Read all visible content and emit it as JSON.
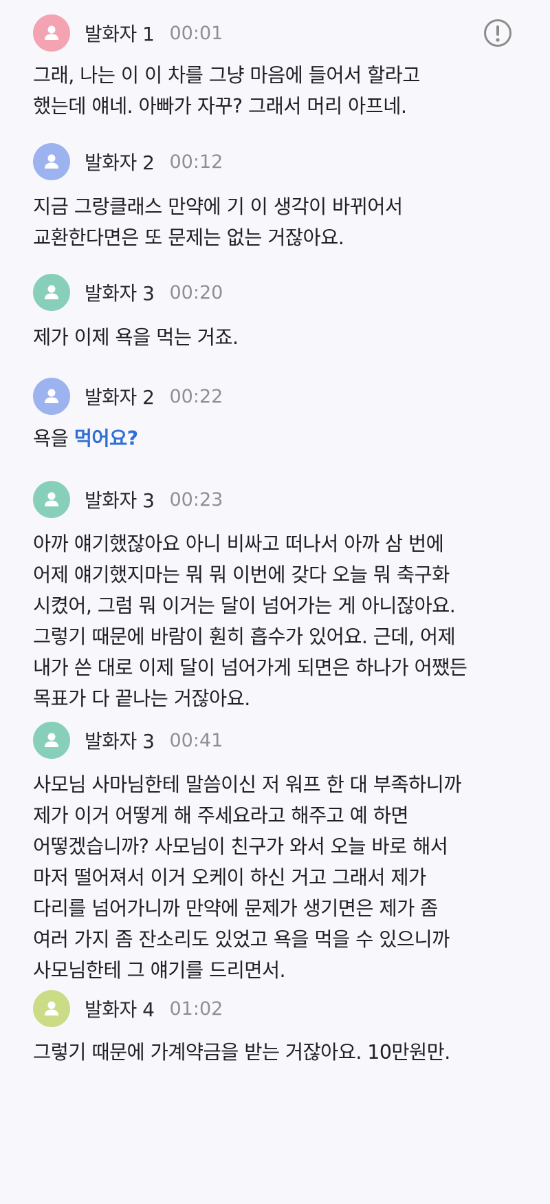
{
  "header": {
    "alert_icon": "exclamation-circle-icon"
  },
  "colors": {
    "speaker_1": "#f4a3b3",
    "speaker_2": "#9db3ef",
    "speaker_3": "#88cfba",
    "speaker_4": "#cbdc86",
    "highlight": "#2f6fd6"
  },
  "segments": [
    {
      "speaker": "발화자 1",
      "time": "00:01",
      "lines": [
        "그래, 나는 이 이 차를 그냥 마음에 들어서 할라고",
        "했는데 얘네. 아빠가 자꾸? 그래서 머리 아프네."
      ]
    },
    {
      "speaker": "발화자 2",
      "time": "00:12",
      "lines": [
        "지금 그랑클래스 만약에 기 이 생각이 바뀌어서",
        "교환한다면은 또 문제는 없는 거잖아요."
      ]
    },
    {
      "speaker": "발화자 3",
      "time": "00:20",
      "lines": [
        "제가 이제 욕을 먹는 거죠."
      ]
    },
    {
      "speaker": "발화자 2",
      "time": "00:22",
      "text_plain": "욕을 ",
      "text_highlight": "먹어요?"
    },
    {
      "speaker": "발화자 3",
      "time": "00:23",
      "lines": [
        "아까 얘기했잖아요 아니 비싸고 떠나서 아까 삼 번에",
        "어제 얘기했지마는 뭐 뭐 이번에 갖다 오늘 뭐 축구화",
        "시켰어, 그럼 뭐 이거는 달이 넘어가는 게 아니잖아요.",
        "그렇기 때문에 바람이 훤히 흡수가 있어요. 근데, 어제",
        "내가 쓴 대로 이제 달이 넘어가게 되면은 하나가 어쨌든",
        "목표가 다 끝나는 거잖아요."
      ]
    },
    {
      "speaker": "발화자 3",
      "time": "00:41",
      "lines": [
        "사모님 사마님한테 말씀이신 저 워프 한 대 부족하니까",
        "제가 이거 어떻게 해 주세요라고 해주고 예 하면",
        "어떻겠습니까? 사모님이 친구가 와서 오늘 바로 해서",
        "마저 떨어져서 이거 오케이 하신 거고 그래서 제가",
        "다리를 넘어가니까 만약에 문제가 생기면은 제가 좀",
        "여러 가지 좀 잔소리도 있었고 욕을 먹을 수 있으니까",
        "사모님한테 그 얘기를 드리면서."
      ]
    },
    {
      "speaker": "발화자 4",
      "time": "01:02",
      "lines": [
        "그렇기 때문에 가계약금을 받는 거잖아요. 10만원만."
      ]
    }
  ]
}
